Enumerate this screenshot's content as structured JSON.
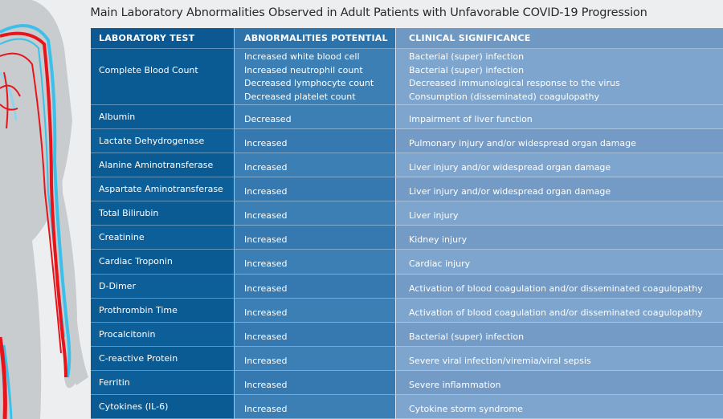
{
  "title": "Main Laboratory Abnormalities Observed in Adult Patients with Unfavorable COVID-19 Progression",
  "illustration": "human-circulatory-system-arm-icon",
  "colors": {
    "column1": "#0a5a94",
    "column2": "#3c7fb4",
    "column3": "#7ea5cd",
    "artery": "#e8141c",
    "vein": "#3cc0ea",
    "body": "#c9ccce",
    "background": "#eceef0"
  },
  "table": {
    "headers": [
      "LABORATORY TEST",
      "ABNORMALITIES  POTENTIAL",
      "CLINICAL SIGNIFICANCE"
    ],
    "cbc": {
      "test": "Complete Blood Count",
      "abnormalities": [
        "Increased white blood cell",
        "Increased neutrophil count",
        "Decreased lymphocyte count",
        "Decreased platelet count"
      ],
      "significance": [
        "Bacterial (super) infection",
        "Bacterial (super) infection",
        "Decreased immunological response to the virus",
        "Consumption (disseminated) coagulopathy"
      ]
    },
    "rows": [
      {
        "test": "Albumin",
        "abnormality": "Decreased",
        "significance": "Impairment of liver function"
      },
      {
        "test": "Lactate Dehydrogenase",
        "abnormality": "Increased",
        "significance": "Pulmonary injury and/or widespread organ damage"
      },
      {
        "test": "Alanine Aminotransferase",
        "abnormality": "Increased",
        "significance": "Liver injury and/or widespread organ damage"
      },
      {
        "test": "Aspartate Aminotransferase",
        "abnormality": "Increased",
        "significance": "Liver injury and/or widespread organ damage"
      },
      {
        "test": "Total Bilirubin",
        "abnormality": "Increased",
        "significance": "Liver injury"
      },
      {
        "test": "Creatinine",
        "abnormality": "Increased",
        "significance": "Kidney injury"
      },
      {
        "test": "Cardiac Troponin",
        "abnormality": "Increased",
        "significance": "Cardiac injury"
      },
      {
        "test": "D-Dimer",
        "abnormality": "Increased",
        "significance": "Activation of blood coagulation and/or disseminated coagulopathy"
      },
      {
        "test": "Prothrombin Time",
        "abnormality": "Increased",
        "significance": "Activation of blood coagulation and/or disseminated coagulopathy"
      },
      {
        "test": "Procalcitonin",
        "abnormality": "Increased",
        "significance": "Bacterial (super) infection"
      },
      {
        "test": "C-reactive Protein",
        "abnormality": "Increased",
        "significance": "Severe viral infection/viremia/viral sepsis"
      },
      {
        "test": "Ferritin",
        "abnormality": "Increased",
        "significance": "Severe inflammation"
      },
      {
        "test": "Cytokines (IL-6)",
        "abnormality": "Increased",
        "significance": "Cytokine storm syndrome"
      }
    ]
  }
}
